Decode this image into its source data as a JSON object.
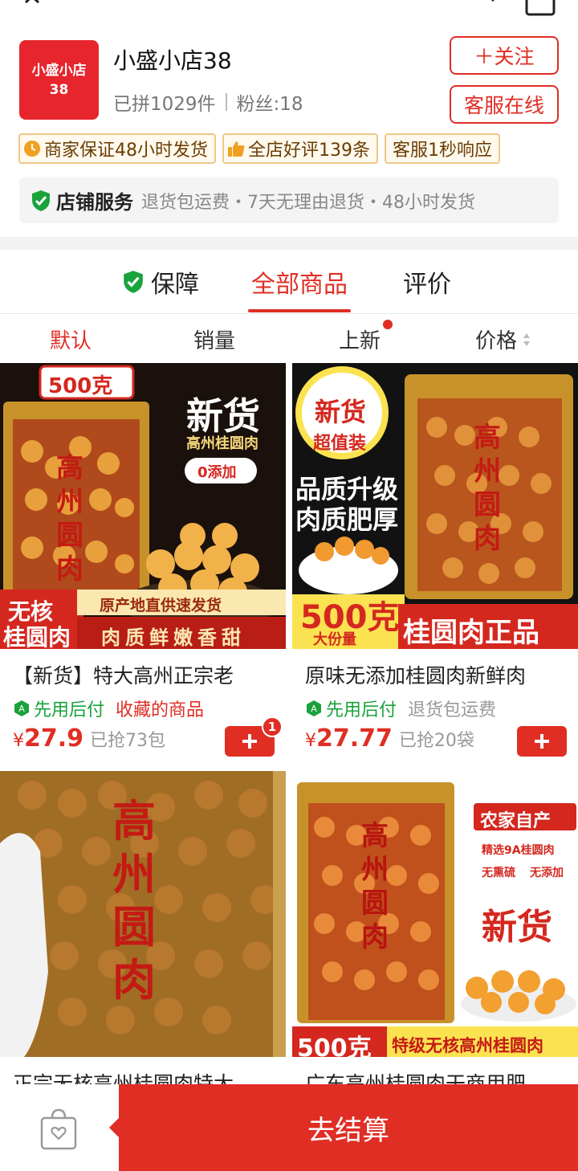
{
  "store": {
    "logo_line1": "小盛小店",
    "logo_line2": "38",
    "name": "小盛小店38",
    "sold": "已拼1029件",
    "fans": "粉丝:18",
    "follow_label": "＋关注",
    "service_label": "客服在线"
  },
  "badges": [
    {
      "label": "商家保证48小时发货",
      "icon": "clock-icon"
    },
    {
      "label": "全店好评139条",
      "icon": "thumbs-up-icon"
    },
    {
      "label": "客服1秒响应",
      "icon": ""
    }
  ],
  "shop_service": {
    "title": "店铺服务",
    "desc": "退货包运费・7天无理由退货・48小时发货"
  },
  "tabs": [
    {
      "label": "保障"
    },
    {
      "label": "全部商品"
    },
    {
      "label": "评价"
    }
  ],
  "sort": [
    {
      "label": "默认"
    },
    {
      "label": "销量"
    },
    {
      "label": "上新"
    },
    {
      "label": "价格"
    }
  ],
  "products": [
    {
      "title": "【新货】特大高州正宗老",
      "pay_later": "先用后付",
      "extra_tag": "收藏的商品",
      "price_symbol": "¥",
      "price": "27.9",
      "sold": "已抢73包",
      "cart_count": "1",
      "img": {
        "weight": "500克",
        "headline": "新货",
        "sub": "高州桂圆肉",
        "zero": "0添加",
        "corner1": "无核",
        "corner2": "桂圆肉",
        "bar_top": "原产地直供速发货",
        "bar_bottom": "肉质鲜嫩香甜",
        "bag_text": "高州圆肉"
      }
    },
    {
      "title": "原味无添加桂圆肉新鲜肉",
      "pay_later": "先用后付",
      "extra_tag": "退货包运费",
      "price_symbol": "¥",
      "price": "27.77",
      "sold": "已抢20袋",
      "img": {
        "badge1": "新货",
        "badge2": "超值装",
        "line1": "品质升级",
        "line2": "肉质肥厚",
        "weight": "500克",
        "weight_sub": "大份量",
        "bar": "桂圆肉正品",
        "bag_text": "高州圆肉"
      }
    },
    {
      "title": "正宗无核高州桂圆肉特大",
      "img": {
        "bag_text": "高州圆肉"
      }
    },
    {
      "title": "广东高州桂圆肉干商用肥",
      "img": {
        "tag1": "农家自产",
        "tag2": "精选9A桂圆肉",
        "tag3": "无熏硫",
        "tag4": "无添加",
        "headline": "新货",
        "weight": "500克",
        "bar": "特级无核高州桂圆肉",
        "bag_text": "高州圆肉"
      }
    }
  ],
  "checkout": {
    "label": "去结算"
  },
  "colors": {
    "brand_red": "#e02e24",
    "pay_green": "#1aa33b"
  }
}
